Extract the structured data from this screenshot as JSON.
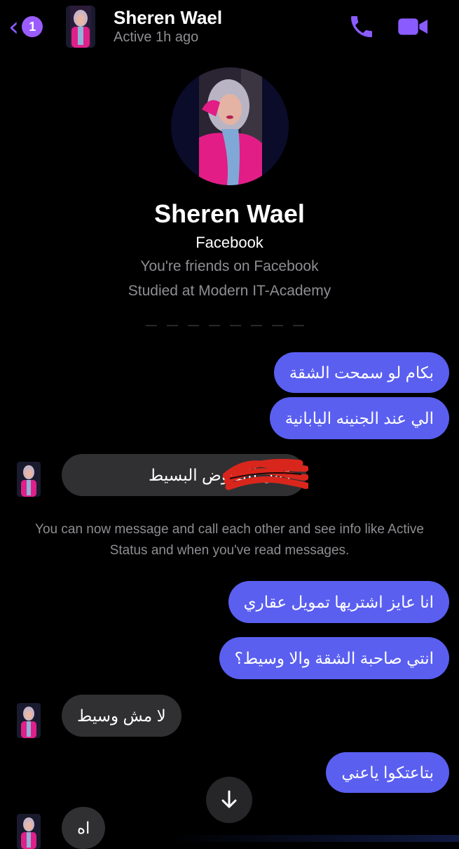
{
  "header": {
    "back_badge": "1",
    "contact_name": "Sheren Wael",
    "status": "Active 1h ago",
    "call_icon": "phone-icon",
    "video_icon": "video-camera-icon"
  },
  "profile": {
    "name": "Sheren Wael",
    "platform": "Facebook",
    "friendship": "You're friends on Facebook",
    "education": "Studied at Modern IT-Academy"
  },
  "messages": [
    {
      "direction": "outgoing",
      "text": "بكام لو سمحت الشقة"
    },
    {
      "direction": "outgoing",
      "text": "الي عند الجنينه اليابانية"
    },
    {
      "direction": "incoming",
      "text": "قابل للتفاوض البسيط"
    },
    {
      "direction": "outgoing",
      "text": "انا عايز اشتريها تمويل عقاري"
    },
    {
      "direction": "outgoing",
      "text": "انتي صاحبة الشقة والا وسيط؟"
    },
    {
      "direction": "incoming",
      "text": "لا مش وسيط"
    },
    {
      "direction": "outgoing",
      "text": "بتاعتكوا ياعني"
    },
    {
      "direction": "incoming",
      "text": "اه"
    }
  ],
  "info_notice": "You can now message and call each other and see info like Active Status and when you've read messages.",
  "colors": {
    "accent": "#8a5cff",
    "outgoing_bubble": "#5a5ff0",
    "incoming_bubble": "#303033",
    "background": "#000000"
  }
}
